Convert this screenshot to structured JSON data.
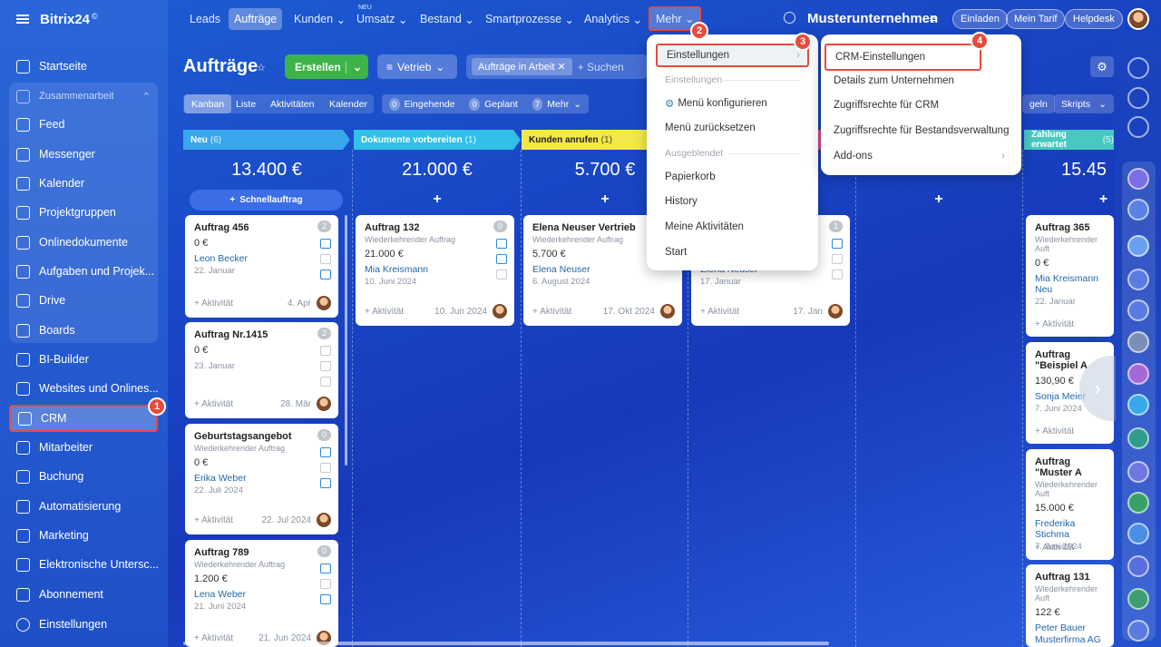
{
  "app": {
    "logo": "Bitrix24",
    "company": "Musterunternehmen",
    "invite": "Einladen",
    "tariff": "Mein Tarif",
    "helpdesk": "Helpdesk"
  },
  "topnav": {
    "leads": "Leads",
    "deals": "Aufträge",
    "customers": "Kunden",
    "sales": "Umsatz",
    "sales_new": "NEU",
    "inventory": "Bestand",
    "smart": "Smartprozesse",
    "analytics": "Analytics",
    "more": "Mehr"
  },
  "sidebar": {
    "home": "Startseite",
    "collab": "Zusammenarbeit",
    "feed": "Feed",
    "messenger": "Messenger",
    "calendar": "Kalender",
    "groups": "Projektgruppen",
    "docs": "Onlinedokumente",
    "tasks": "Aufgaben und Projek...",
    "drive": "Drive",
    "boards": "Boards",
    "bi": "BI-Builder",
    "sites": "Websites und Onlines...",
    "crm": "CRM",
    "employees": "Mitarbeiter",
    "booking": "Buchung",
    "automation": "Automatisierung",
    "marketing": "Marketing",
    "esign": "Elektronische Untersc...",
    "subscription": "Abonnement",
    "settings": "Einstellungen"
  },
  "toolbar": {
    "title": "Aufträge",
    "create": "Erstellen",
    "pipeline": "Vetrieb",
    "filter": "Aufträge in Arbeit",
    "search_placeholder": "+ Suchen",
    "scripts": "Skripts",
    "gen": "geln"
  },
  "views": {
    "kanban": "Kanban",
    "list": "Liste",
    "activities": "Aktivitäten",
    "calendar": "Kalender",
    "incoming": "Eingehende",
    "incoming_n": "0",
    "planned": "Geplant",
    "planned_n": "0",
    "more": "Mehr",
    "more_n": "7"
  },
  "stages": [
    {
      "name": "Neu",
      "count": "(6)",
      "sum": "13.400 €",
      "color": "#39a7ec"
    },
    {
      "name": "Dokumente vorbereiten",
      "count": "(1)",
      "sum": "21.000 €",
      "color": "#30c0e8"
    },
    {
      "name": "Kunden anrufen",
      "count": "(1)",
      "sum": "5.700 €",
      "color": "#f2e84a"
    },
    {
      "name": "Zahlung erwartet",
      "count": "(5)",
      "sum": "15.45",
      "color": "#48c8c0"
    }
  ],
  "quick": "Schnellauftrag",
  "cards": {
    "c1": {
      "title": "Auftrag 456",
      "amount": "0 €",
      "contact": "Leon Becker",
      "date": "22. Januar",
      "act": "+ Aktivität",
      "adate": "4. Apr",
      "n": "2"
    },
    "c2": {
      "title": "Auftrag Nr.1415",
      "amount": "0 €",
      "date": "23. Januar",
      "act": "+ Aktivität",
      "adate": "28. Mär",
      "n": "2"
    },
    "c3": {
      "title": "Geburtstagsangebot",
      "sub": "Wiederkehrender Auftrag",
      "amount": "0 €",
      "contact": "Erika Weber",
      "date": "22. Juli 2024",
      "act": "+ Aktivität",
      "adate": "22. Jul 2024",
      "n": "0"
    },
    "c4": {
      "title": "Auftrag 789",
      "sub": "Wiederkehrender Auftrag",
      "amount": "1.200 €",
      "contact": "Lena Weber",
      "date": "21. Juni 2024",
      "act": "+ Aktivität",
      "adate": "21. Jun 2024",
      "n": "0"
    },
    "c5": {
      "title": "Auftrag 132",
      "sub": "Wiederkehrender Auftrag",
      "amount": "21.000 €",
      "contact": "Mia Kreismann",
      "date": "10. Juni 2024",
      "act": "+ Aktivität",
      "adate": "10. Jun 2024",
      "n": "0"
    },
    "c6": {
      "title": "Elena Neuser Vertrieb",
      "sub": "Wiederkehrender Auftrag",
      "amount": "5.700 €",
      "contact": "Elena Neuser",
      "date": "6. August 2024",
      "act": "+ Aktivität",
      "adate": "17. Okt 2024"
    },
    "c7": {
      "contact": "Elena Neuser",
      "date": "17. Januar",
      "act": "+ Aktivität",
      "adate": "17. Jan",
      "n": "1"
    },
    "c8": {
      "title": "Auftrag 365",
      "sub": "Wiederkehrender Auft",
      "amount": "0 €",
      "contact": "Mia Kreismann Neu",
      "date": "22. Januar",
      "act": "+ Aktivität"
    },
    "c9": {
      "title": "Auftrag \"Beispiel A",
      "amount": "130,90 €",
      "contact": "Sonja Meier",
      "date": "7. Juni 2024",
      "act": "+ Aktivität"
    },
    "c10": {
      "title": "Auftrag \"Muster A",
      "sub": "Wiederkehrender Auft",
      "amount": "15.000 €",
      "contact": "Frederika Stichma",
      "date": "7. Juni 2024",
      "act": "+ Aktivität"
    },
    "c11": {
      "title": "Auftrag 131",
      "sub": "Wiederkehrender Auft",
      "amount": "122 €",
      "contact": "Peter Bauer",
      "contact2": "Musterfirma AG"
    }
  },
  "menu_more": {
    "settings": "Einstellungen",
    "settings_hdr": "Einstellungen",
    "configure": "Menü konfigurieren",
    "reset": "Menü zurücksetzen",
    "hidden_hdr": "Ausgeblendet",
    "trash": "Papierkorb",
    "history": "History",
    "my_act": "Meine Aktivitäten",
    "start": "Start"
  },
  "menu_settings": {
    "crm_settings": "CRM-Einstellungen",
    "company": "Details zum Unternehmen",
    "crm_access": "Zugriffsrechte für CRM",
    "inv_access": "Zugriffsrechte für Bestandsverwaltung",
    "addons": "Add-ons"
  },
  "steps": [
    "1",
    "2",
    "3",
    "4"
  ]
}
